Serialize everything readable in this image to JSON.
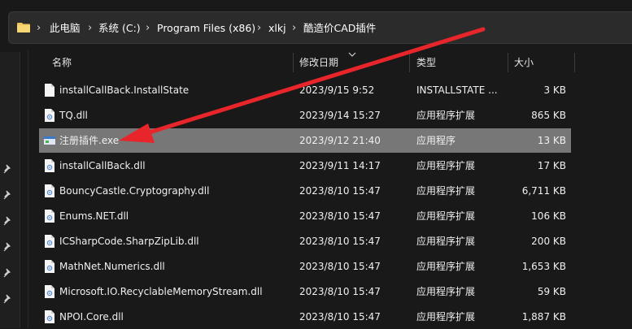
{
  "breadcrumb": {
    "items": [
      "此电脑",
      "系统 (C:)",
      "Program Files (x86)",
      "xlkj",
      "酷造价CAD插件"
    ]
  },
  "columns": {
    "name": "名称",
    "date": "修改日期",
    "type": "类型",
    "size": "大小"
  },
  "files": [
    {
      "name": "installCallBack.InstallState",
      "date": "2023/9/15 9:52",
      "type": "INSTALLSTATE ...",
      "size": "3 KB",
      "icon": "file-icon"
    },
    {
      "name": "TQ.dll",
      "date": "2023/9/14 15:27",
      "type": "应用程序扩展",
      "size": "865 KB",
      "icon": "dll-icon"
    },
    {
      "name": "注册插件.exe",
      "date": "2023/9/12 21:40",
      "type": "应用程序",
      "size": "13 KB",
      "icon": "exe-icon"
    },
    {
      "name": "installCallBack.dll",
      "date": "2023/9/11 14:17",
      "type": "应用程序扩展",
      "size": "17 KB",
      "icon": "dll-icon"
    },
    {
      "name": "BouncyCastle.Cryptography.dll",
      "date": "2023/8/10 15:47",
      "type": "应用程序扩展",
      "size": "6,711 KB",
      "icon": "dll-icon"
    },
    {
      "name": "Enums.NET.dll",
      "date": "2023/8/10 15:47",
      "type": "应用程序扩展",
      "size": "106 KB",
      "icon": "dll-icon"
    },
    {
      "name": "ICSharpCode.SharpZipLib.dll",
      "date": "2023/8/10 15:47",
      "type": "应用程序扩展",
      "size": "200 KB",
      "icon": "dll-icon"
    },
    {
      "name": "MathNet.Numerics.dll",
      "date": "2023/8/10 15:47",
      "type": "应用程序扩展",
      "size": "1,653 KB",
      "icon": "dll-icon"
    },
    {
      "name": "Microsoft.IO.RecyclableMemoryStream.dll",
      "date": "2023/8/10 15:47",
      "type": "应用程序扩展",
      "size": "59 KB",
      "icon": "dll-icon"
    },
    {
      "name": "NPOI.Core.dll",
      "date": "2023/8/10 15:47",
      "type": "应用程序扩展",
      "size": "1,887 KB",
      "icon": "dll-icon"
    }
  ],
  "selected_index": 2,
  "colors": {
    "annotation_arrow": "#e8252b",
    "selection": "#777777",
    "folder": "#f2c55c"
  }
}
